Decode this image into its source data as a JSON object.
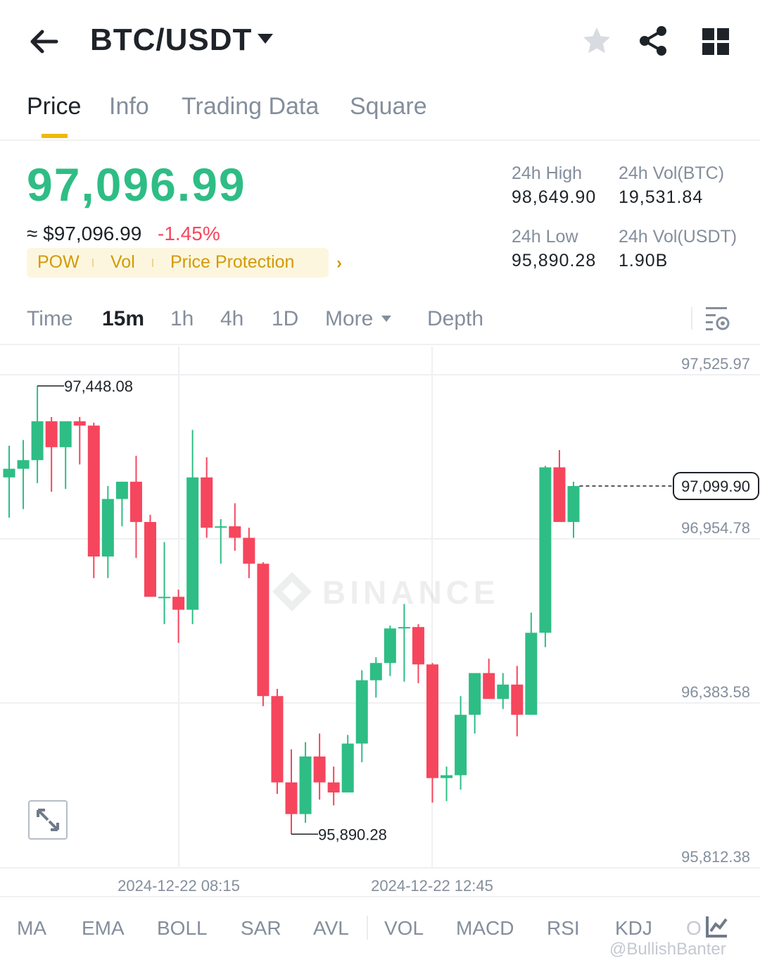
{
  "header": {
    "pair": "BTC/USDT",
    "icons": [
      "back-arrow-icon",
      "caret-down-icon",
      "star-icon",
      "share-icon",
      "grid-icon"
    ]
  },
  "tabs": [
    {
      "label": "Price",
      "active": true
    },
    {
      "label": "Info",
      "active": false
    },
    {
      "label": "Trading Data",
      "active": false
    },
    {
      "label": "Square",
      "active": false
    }
  ],
  "price": {
    "last": "97,096.99",
    "usd": "≈ $97,096.99",
    "change": "-1.45%",
    "tags": [
      "POW",
      "Vol",
      "Price Protection"
    ]
  },
  "stats": {
    "high_label": "24h High",
    "high": "98,649.90",
    "vol_btc_label": "24h Vol(BTC)",
    "vol_btc": "19,531.84",
    "low_label": "24h Low",
    "low": "95,890.28",
    "vol_usdt_label": "24h Vol(USDT)",
    "vol_usdt": "1.90B"
  },
  "intervals": {
    "items": [
      "Time",
      "15m",
      "1h",
      "4h",
      "1D",
      "More",
      "Depth"
    ],
    "active": "15m"
  },
  "chart_data": {
    "type": "candlestick",
    "y_ticks": [
      "97,525.97",
      "96,954.78",
      "96,383.58",
      "95,812.38"
    ],
    "x_ticks": [
      "2024-12-22 08:15",
      "2024-12-22 12:45"
    ],
    "high_marker": "97,448.08",
    "low_marker": "95,890.28",
    "current_price": "97,099.90",
    "watermark": "BINANCE",
    "colors": {
      "up": "#2ebd85",
      "down": "#f6465d",
      "grid": "#eef0f2"
    },
    "candles": [
      {
        "o": 97130,
        "h": 97240,
        "l": 96990,
        "c": 97160
      },
      {
        "o": 97160,
        "h": 97260,
        "l": 97020,
        "c": 97190
      },
      {
        "o": 97190,
        "h": 97448,
        "l": 97110,
        "c": 97325
      },
      {
        "o": 97325,
        "h": 97340,
        "l": 97080,
        "c": 97235
      },
      {
        "o": 97235,
        "h": 97260,
        "l": 97090,
        "c": 97325
      },
      {
        "o": 97325,
        "h": 97340,
        "l": 97175,
        "c": 97310
      },
      {
        "o": 97310,
        "h": 97320,
        "l": 96780,
        "c": 96855
      },
      {
        "o": 96855,
        "h": 97100,
        "l": 96780,
        "c": 97055
      },
      {
        "o": 97055,
        "h": 97100,
        "l": 96960,
        "c": 97115
      },
      {
        "o": 97115,
        "h": 97205,
        "l": 96850,
        "c": 96975
      },
      {
        "o": 96975,
        "h": 97000,
        "l": 96730,
        "c": 96715
      },
      {
        "o": 96715,
        "h": 96905,
        "l": 96620,
        "c": 96715
      },
      {
        "o": 96715,
        "h": 96740,
        "l": 96555,
        "c": 96670
      },
      {
        "o": 96670,
        "h": 97295,
        "l": 96620,
        "c": 97130
      },
      {
        "o": 97130,
        "h": 97200,
        "l": 96920,
        "c": 96955
      },
      {
        "o": 96955,
        "h": 96985,
        "l": 96830,
        "c": 96960
      },
      {
        "o": 96960,
        "h": 97040,
        "l": 96875,
        "c": 96920
      },
      {
        "o": 96920,
        "h": 96955,
        "l": 96780,
        "c": 96830
      },
      {
        "o": 96830,
        "h": 96835,
        "l": 96335,
        "c": 96370
      },
      {
        "o": 96370,
        "h": 96395,
        "l": 96030,
        "c": 96070
      },
      {
        "o": 96070,
        "h": 96185,
        "l": 95890,
        "c": 95960
      },
      {
        "o": 95960,
        "h": 96210,
        "l": 95930,
        "c": 96160
      },
      {
        "o": 96160,
        "h": 96240,
        "l": 96010,
        "c": 96070
      },
      {
        "o": 96070,
        "h": 96125,
        "l": 95990,
        "c": 96035
      },
      {
        "o": 96035,
        "h": 96235,
        "l": 96035,
        "c": 96205
      },
      {
        "o": 96205,
        "h": 96460,
        "l": 96140,
        "c": 96425
      },
      {
        "o": 96425,
        "h": 96505,
        "l": 96365,
        "c": 96485
      },
      {
        "o": 96485,
        "h": 96615,
        "l": 96440,
        "c": 96605
      },
      {
        "o": 96605,
        "h": 96690,
        "l": 96420,
        "c": 96610
      },
      {
        "o": 96610,
        "h": 96620,
        "l": 96415,
        "c": 96480
      },
      {
        "o": 96480,
        "h": 96485,
        "l": 96000,
        "c": 96085
      },
      {
        "o": 96085,
        "h": 96125,
        "l": 96005,
        "c": 96095
      },
      {
        "o": 96095,
        "h": 96370,
        "l": 96045,
        "c": 96305
      },
      {
        "o": 96305,
        "h": 96440,
        "l": 96240,
        "c": 96450
      },
      {
        "o": 96450,
        "h": 96500,
        "l": 96370,
        "c": 96360
      },
      {
        "o": 96360,
        "h": 96450,
        "l": 96325,
        "c": 96410
      },
      {
        "o": 96410,
        "h": 96475,
        "l": 96230,
        "c": 96305
      },
      {
        "o": 96305,
        "h": 96660,
        "l": 96305,
        "c": 96590
      },
      {
        "o": 96590,
        "h": 97170,
        "l": 96540,
        "c": 97165
      },
      {
        "o": 97165,
        "h": 97225,
        "l": 96980,
        "c": 96975
      },
      {
        "o": 96975,
        "h": 97115,
        "l": 96920,
        "c": 97100
      }
    ]
  },
  "indicators": [
    "MA",
    "EMA",
    "BOLL",
    "SAR",
    "AVL",
    "VOL",
    "MACD",
    "RSI",
    "KDJ",
    "O"
  ],
  "credit": "@BullishBanter"
}
